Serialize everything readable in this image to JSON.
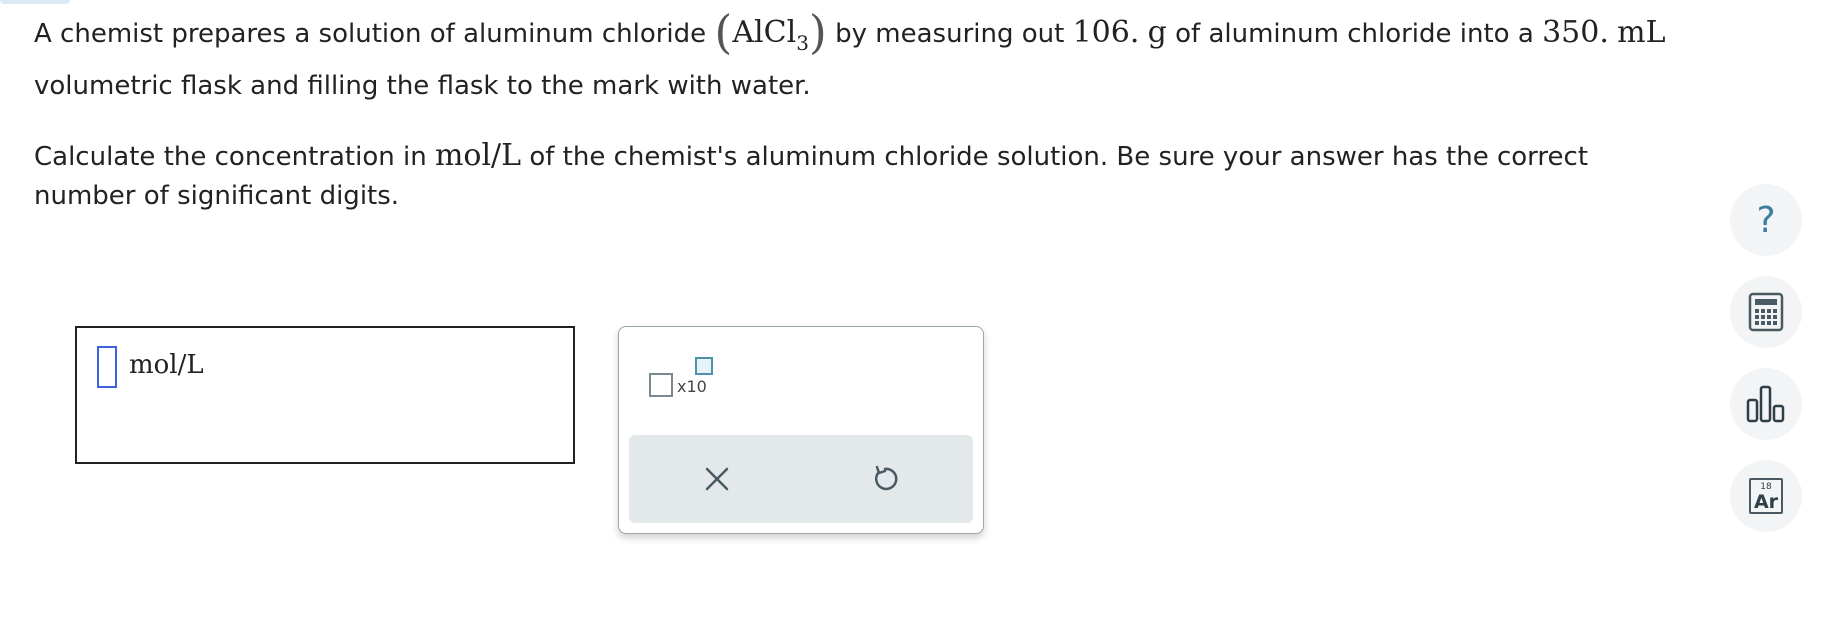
{
  "question": {
    "line1_a": "A chemist prepares a solution of aluminum chloride",
    "formula_main": "AlCl",
    "formula_sub": "3",
    "line1_b": "by measuring out",
    "mass_value": "106.",
    "mass_unit": "g",
    "line1_c": "of aluminum chloride into a",
    "volume_value": "350.",
    "volume_unit": "mL",
    "line2": "volumetric flask and filling the flask to the mark with water.",
    "line3_a": "Calculate the concentration in",
    "conc_unit": "mol/L",
    "line3_b": "of the chemist's aluminum chloride solution. Be sure your answer has the correct",
    "line4": "number of significant digits."
  },
  "answer": {
    "value": "",
    "unit": "mol/L"
  },
  "keypad": {
    "sci_notation_label": "x10",
    "clear_icon": "close-icon",
    "undo_icon": "undo-icon"
  },
  "sidebar": {
    "help_label": "?",
    "calculator_icon": "calculator-icon",
    "chart_icon": "bar-chart-icon",
    "periodic_number": "18",
    "periodic_symbol": "Ar"
  },
  "colors": {
    "accent": "#3d7ea0",
    "input_cursor": "#3b63e0",
    "action_bar": "#e3e8eb"
  }
}
